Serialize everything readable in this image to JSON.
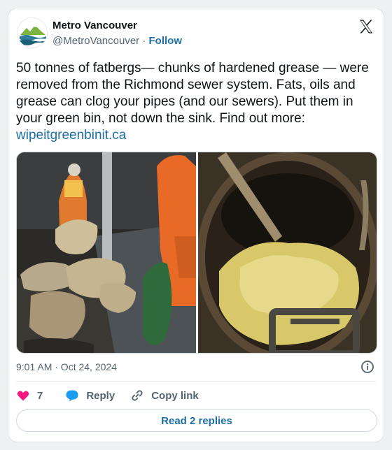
{
  "author": {
    "name": "Metro Vancouver",
    "handle": "@MetroVancouver",
    "separator": "·",
    "follow_label": "Follow",
    "avatar_icon": "mountain-wave-logo"
  },
  "brand_icon": "x-logo",
  "tweet": {
    "text": "50 tonnes of fatbergs— chunks of hardened grease — were removed from the Richmond sewer system. Fats, oils and grease can clog your pipes (and our sewers). Put them in your green bin, not down the sink. Find out more: ",
    "link_text": "wipeitgreenbinit.ca",
    "media": [
      {
        "description_icon": "fatberg-workers-photo"
      },
      {
        "description_icon": "grease-in-sewer-photo"
      }
    ]
  },
  "meta": {
    "timestamp": "9:01 AM · Oct 24, 2024",
    "info_icon": "info-icon"
  },
  "actions": {
    "like_count": "7",
    "reply_label": "Reply",
    "copy_label": "Copy link"
  },
  "read_replies_label": "Read 2 replies",
  "colors": {
    "accent": "#1d6fa5",
    "like": "#f91880",
    "reply": "#1d9bf0",
    "muted": "#536471"
  }
}
